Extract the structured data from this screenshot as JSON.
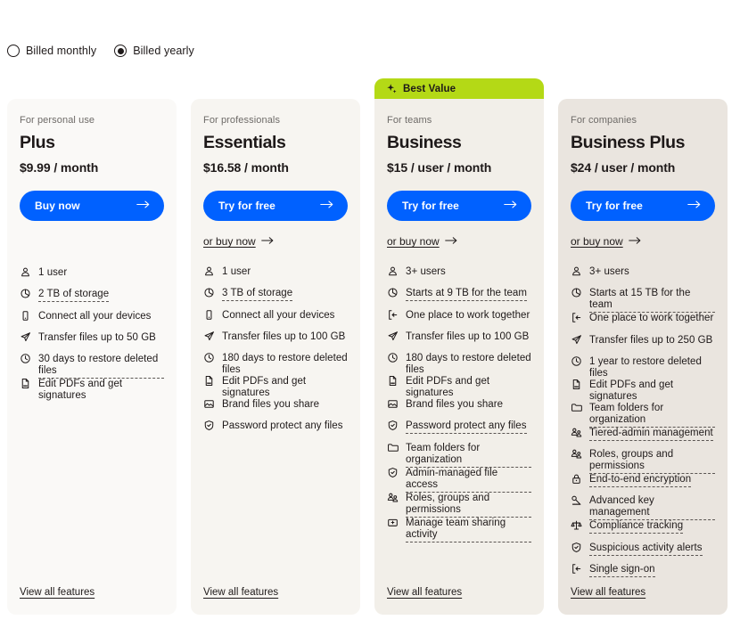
{
  "billing": {
    "options": [
      {
        "label": "Billed monthly",
        "selected": false
      },
      {
        "label": "Billed yearly",
        "selected": true
      }
    ]
  },
  "colors": {
    "cta_blue": "#0061ff",
    "badge_green": "#b4d916",
    "text": "#1e1919",
    "eyebrow": "#6e6b68",
    "card_1_bg": "#faf9f7",
    "card_2_bg": "#f7f5f1",
    "card_3_bg": "#f2efe9",
    "card_4_bg": "#eae5df"
  },
  "plans": [
    {
      "eyebrow": "For personal use",
      "name": "Plus",
      "price": "$9.99 / month",
      "cta_label": "Buy now",
      "buy_link": null,
      "badge": null,
      "view_all_label": "View all features",
      "features": [
        {
          "icon": "user-icon",
          "text": "1 user",
          "tooltip": false
        },
        {
          "icon": "storage-icon",
          "text": "2 TB of storage",
          "tooltip": true
        },
        {
          "icon": "device-icon",
          "text": "Connect all your devices",
          "tooltip": false
        },
        {
          "icon": "send-icon",
          "text": "Transfer files up to 50 GB",
          "tooltip": false
        },
        {
          "icon": "clock-icon",
          "text": "30 days to restore deleted files",
          "tooltip": true
        },
        {
          "icon": "pdf-icon",
          "text": "Edit PDFs and get signatures",
          "tooltip": false
        }
      ]
    },
    {
      "eyebrow": "For professionals",
      "name": "Essentials",
      "price": "$16.58 / month",
      "cta_label": "Try for free",
      "buy_link": "or buy now",
      "badge": null,
      "view_all_label": "View all features",
      "features": [
        {
          "icon": "user-icon",
          "text": "1 user",
          "tooltip": false
        },
        {
          "icon": "storage-icon",
          "text": "3 TB of storage",
          "tooltip": true
        },
        {
          "icon": "device-icon",
          "text": "Connect all your devices",
          "tooltip": false
        },
        {
          "icon": "send-icon",
          "text": "Transfer files up to 100 GB",
          "tooltip": false
        },
        {
          "icon": "clock-icon",
          "text": "180 days to restore deleted files",
          "tooltip": false
        },
        {
          "icon": "pdf-icon",
          "text": "Edit PDFs and get signatures",
          "tooltip": false
        },
        {
          "icon": "brand-icon",
          "text": "Brand files you share",
          "tooltip": false
        },
        {
          "icon": "shield-icon",
          "text": "Password protect any files",
          "tooltip": false
        }
      ]
    },
    {
      "eyebrow": "For teams",
      "name": "Business",
      "price": "$15 / user / month",
      "cta_label": "Try for free",
      "buy_link": "or buy now",
      "badge": "Best Value",
      "view_all_label": "View all features",
      "features": [
        {
          "icon": "user-icon",
          "text": "3+ users",
          "tooltip": false
        },
        {
          "icon": "storage-icon",
          "text": "Starts at 9 TB for the team",
          "tooltip": true
        },
        {
          "icon": "workspace-icon",
          "text": "One place to work together",
          "tooltip": false
        },
        {
          "icon": "send-icon",
          "text": "Transfer files up to 100 GB",
          "tooltip": false
        },
        {
          "icon": "clock-icon",
          "text": "180 days to restore deleted files",
          "tooltip": false
        },
        {
          "icon": "pdf-icon",
          "text": "Edit PDFs and get signatures",
          "tooltip": false
        },
        {
          "icon": "brand-icon",
          "text": "Brand files you share",
          "tooltip": false
        },
        {
          "icon": "shield-icon",
          "text": "Password protect any files",
          "tooltip": true
        },
        {
          "icon": "folder-icon",
          "text": "Team folders for organization",
          "tooltip": true
        },
        {
          "icon": "shield-icon",
          "text": "Admin-managed file access",
          "tooltip": true
        },
        {
          "icon": "roles-icon",
          "text": "Roles, groups and permissions",
          "tooltip": true
        },
        {
          "icon": "activity-icon",
          "text": "Manage team sharing activity",
          "tooltip": true
        }
      ]
    },
    {
      "eyebrow": "For companies",
      "name": "Business Plus",
      "price": "$24 / user / month",
      "cta_label": "Try for free",
      "buy_link": "or buy now",
      "badge": null,
      "view_all_label": "View all features",
      "features": [
        {
          "icon": "user-icon",
          "text": "3+ users",
          "tooltip": false
        },
        {
          "icon": "storage-icon",
          "text": "Starts at 15 TB for the team",
          "tooltip": true
        },
        {
          "icon": "workspace-icon",
          "text": "One place to work together",
          "tooltip": false
        },
        {
          "icon": "send-icon",
          "text": "Transfer files up to 250 GB",
          "tooltip": false
        },
        {
          "icon": "clock-icon",
          "text": "1 year to restore deleted files",
          "tooltip": false
        },
        {
          "icon": "pdf-icon",
          "text": "Edit PDFs and get signatures",
          "tooltip": false
        },
        {
          "icon": "folder-icon",
          "text": "Team folders for organization",
          "tooltip": true
        },
        {
          "icon": "roles-icon",
          "text": "Tiered-admin management",
          "tooltip": true
        },
        {
          "icon": "roles-icon",
          "text": "Roles, groups and permissions",
          "tooltip": true
        },
        {
          "icon": "lock-icon",
          "text": "End-to-end encryption",
          "tooltip": true
        },
        {
          "icon": "key-icon",
          "text": "Advanced key management",
          "tooltip": true
        },
        {
          "icon": "scales-icon",
          "text": "Compliance tracking",
          "tooltip": true
        },
        {
          "icon": "shield-icon",
          "text": "Suspicious activity alerts",
          "tooltip": true
        },
        {
          "icon": "workspace-icon",
          "text": "Single sign-on",
          "tooltip": true
        }
      ]
    }
  ]
}
